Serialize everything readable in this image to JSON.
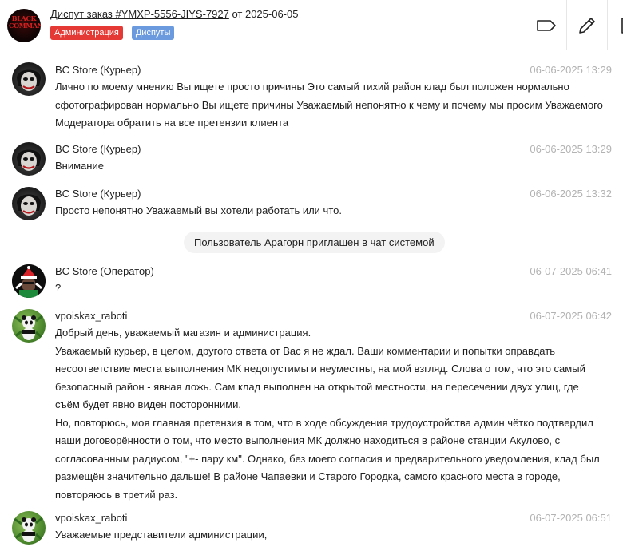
{
  "header": {
    "logo_text": "BLACK COMMAND",
    "title_link": "Диспут заказ #YMXP-5556-JIYS-7927",
    "title_suffix": " от 2025-06-05",
    "badges": [
      "Администрация",
      "Диспуты"
    ],
    "actions": [
      {
        "icon": "tag-icon"
      },
      {
        "icon": "pencil-icon"
      },
      {
        "icon": "document-icon"
      }
    ]
  },
  "messages": [
    {
      "sender": "BC Store (Курьер)",
      "time": "06-06-2025 13:29",
      "lines": [
        "Лично по моему мнению Вы ищете просто причины Это самый тихий район клад был положен нормально сфотографирован нормально Вы ищете причины Уважаемый непонятно к чему и почему мы просим Уважаемого Модератора обратить на все претензии клиента"
      ]
    },
    {
      "sender": "BC Store (Курьер)",
      "time": "06-06-2025 13:29",
      "lines": [
        "Внимание"
      ]
    },
    {
      "sender": "BC Store (Курьер)",
      "time": "06-06-2025 13:32",
      "lines": [
        "Просто непонятно Уважаемый вы хотели работать или что."
      ]
    },
    {
      "sender": "BC Store (Оператор)",
      "time": "06-07-2025 06:41",
      "lines": [
        "?"
      ]
    },
    {
      "sender": "vpoiskax_raboti",
      "time": "06-07-2025 06:42",
      "lines": [
        "Добрый день, уважаемый магазин и администрация.",
        "Уважаемый курьер, в целом, другого ответа от Вас я не ждал. Ваши комментарии и попытки оправдать несоответствие места выполнения МК недопустимы и неуместны, на мой взгляд. Слова о том, что это самый безопасный район - явная ложь. Сам клад выполнен на открытой местности, на пересечении двух улиц, где съём будет явно виден посторонними.",
        "Но, повторюсь, моя главная претензия в том, что в ходе обсуждения трудоустройства админ чётко подтвердил наши договорённости о том, что место выполнения МК должно находиться в районе станции Акулово, с согласованным радиусом, \"+- пару км\". Однако, без моего согласия и предварительного уведомления, клад был размещён значительно дальше! В районе Чапаевки и Старого Городка, самого красного места в городе, повторяюсь в третий раз."
      ]
    },
    {
      "sender": "vpoiskax_raboti",
      "time": "06-07-2025 06:51",
      "lines": [
        "Уважаемые представители администрации,"
      ]
    }
  ],
  "system_note": "Пользователь Арагорн приглашен в чат системой"
}
